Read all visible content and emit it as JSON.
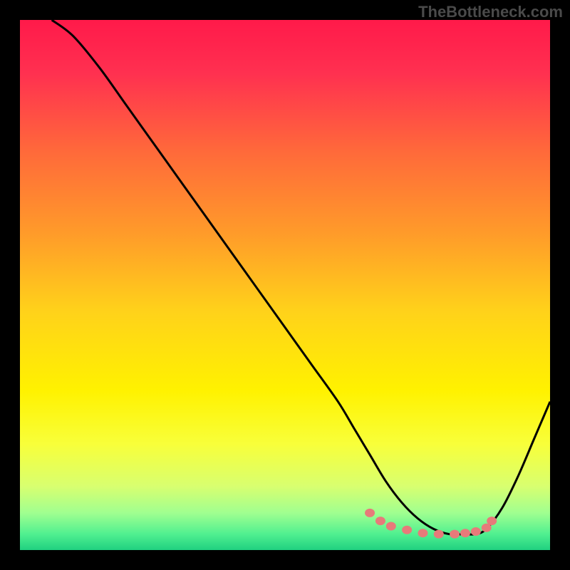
{
  "watermark": "TheBottleneck.com",
  "chart_data": {
    "type": "line",
    "title": "",
    "xlabel": "",
    "ylabel": "",
    "xlim": [
      0,
      100
    ],
    "ylim": [
      0,
      100
    ],
    "series": [
      {
        "name": "bottleneck-curve",
        "x": [
          6,
          10,
          15,
          20,
          25,
          30,
          35,
          40,
          45,
          50,
          55,
          60,
          63,
          66,
          69,
          72,
          75,
          78,
          81,
          84,
          86,
          88,
          91,
          94,
          97,
          100
        ],
        "y": [
          100,
          97,
          91,
          84,
          77,
          70,
          63,
          56,
          49,
          42,
          35,
          28,
          23,
          18,
          13,
          9,
          6,
          4,
          3,
          3,
          3,
          4,
          8,
          14,
          21,
          28
        ]
      }
    ],
    "markers": {
      "name": "optimal-range-markers",
      "x": [
        66,
        68,
        70,
        73,
        76,
        79,
        82,
        84,
        86,
        88,
        89
      ],
      "y": [
        7,
        5.5,
        4.5,
        3.8,
        3.2,
        3,
        3,
        3.2,
        3.5,
        4.2,
        5.5
      ]
    },
    "background_gradient": {
      "stops": [
        {
          "offset": 0.0,
          "color": "#ff1a4a"
        },
        {
          "offset": 0.1,
          "color": "#ff3050"
        },
        {
          "offset": 0.25,
          "color": "#ff6a3a"
        },
        {
          "offset": 0.4,
          "color": "#ff9a2a"
        },
        {
          "offset": 0.55,
          "color": "#ffd21a"
        },
        {
          "offset": 0.7,
          "color": "#fff200"
        },
        {
          "offset": 0.8,
          "color": "#f8ff3a"
        },
        {
          "offset": 0.88,
          "color": "#d8ff70"
        },
        {
          "offset": 0.93,
          "color": "#a0ff90"
        },
        {
          "offset": 0.97,
          "color": "#50f090"
        },
        {
          "offset": 1.0,
          "color": "#20d080"
        }
      ]
    }
  }
}
